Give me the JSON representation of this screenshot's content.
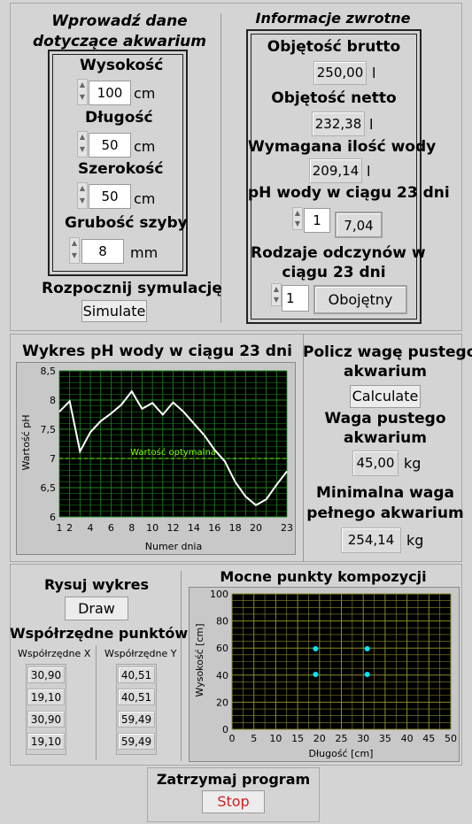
{
  "input_section": {
    "title_line1": "Wprowadź dane",
    "title_line2": "dotyczące akwarium",
    "height_label": "Wysokość",
    "height_value": "100",
    "height_unit": "cm",
    "length_label": "Długość",
    "length_value": "50",
    "length_unit": "cm",
    "width_label": "Szerokość",
    "width_value": "50",
    "width_unit": "cm",
    "glass_label": "Grubość szyby",
    "glass_value": "8",
    "glass_unit": "mm",
    "sim_label": "Rozpocznij symulację",
    "sim_button": "Simulate"
  },
  "feedback_section": {
    "title": "Informacje zwrotne",
    "gross_label": "Objętość brutto",
    "gross_value": "250,00",
    "gross_unit": "l",
    "net_label": "Objętość netto",
    "net_value": "232,38",
    "net_unit": "l",
    "water_label": "Wymagana ilość wody",
    "water_value": "209,14",
    "water_unit": "l",
    "ph_label": "pH wody w ciągu 23 dni",
    "ph_day": "1",
    "ph_value": "7,04",
    "reaction_label_line1": "Rodzaje odczynów w",
    "reaction_label_line2": "ciągu 23 dni",
    "reaction_day": "1",
    "reaction_value": "Obojętny"
  },
  "ph_chart": {
    "title": "Wykres pH wody w ciągu 23 dni",
    "optimal_label": "Wartość optymalna",
    "colors": {
      "bg": "#000000",
      "grid": "#1e8a1e",
      "line": "#ffffff",
      "optimal": "#7cfc00"
    }
  },
  "weight_section": {
    "calc_label_line1": "Policz wagę pustego",
    "calc_label_line2": "akwarium",
    "calc_button": "Calculate",
    "empty_label_line1": "Waga pustego",
    "empty_label_line2": "akwarium",
    "empty_value": "45,00",
    "empty_unit": "kg",
    "full_label_line1": "Minimalna waga",
    "full_label_line2": "pełnego akwarium",
    "full_value": "254,14",
    "full_unit": "kg"
  },
  "draw_section": {
    "draw_label": "Rysuj wykres",
    "draw_button": "Draw",
    "coords_label": "Współrzędne punktów",
    "x_header": "Współrzędne X",
    "y_header": "Współrzędne Y",
    "x_values": [
      "30,90",
      "19,10",
      "30,90",
      "19,10"
    ],
    "y_values": [
      "40,51",
      "40,51",
      "59,49",
      "59,49"
    ]
  },
  "composition_chart": {
    "title": "Mocne punkty kompozycji",
    "colors": {
      "bg": "#000000",
      "grid": "#8a8a2a",
      "point": "#00e5ff"
    }
  },
  "stop_section": {
    "label": "Zatrzymaj program",
    "button": "Stop",
    "button_color": "#d02020"
  },
  "chart_data": [
    {
      "type": "line",
      "title": "Wykres pH wody w ciągu 23 dni",
      "xlabel": "Numer dnia",
      "ylabel": "Wartość pH",
      "x": [
        1,
        2,
        3,
        4,
        5,
        6,
        7,
        8,
        9,
        10,
        11,
        12,
        13,
        14,
        15,
        16,
        17,
        18,
        19,
        20,
        21,
        22,
        23
      ],
      "series": [
        {
          "values": [
            7.8,
            7.98,
            7.12,
            7.45,
            7.64,
            7.77,
            7.92,
            8.15,
            7.85,
            7.95,
            7.75,
            7.96,
            7.8,
            7.6,
            7.4,
            7.15,
            6.95,
            6.6,
            6.35,
            6.2,
            6.3,
            6.55,
            6.78
          ]
        }
      ],
      "reference_line": {
        "label": "Wartość optymalna",
        "y": 7.0
      },
      "xlim": [
        1,
        23
      ],
      "ylim": [
        6,
        8.5
      ],
      "x_ticks": [
        1,
        2,
        4,
        6,
        8,
        10,
        12,
        14,
        16,
        18,
        20,
        23
      ],
      "y_ticks": [
        "6",
        "6,5",
        "7",
        "7,5",
        "8",
        "8,5"
      ],
      "grid": true
    },
    {
      "type": "scatter",
      "title": "Mocne punkty kompozycji",
      "xlabel": "Długość [cm]",
      "ylabel": "Wysokość [cm]",
      "series": [
        {
          "x": [
            19.1,
            30.9,
            19.1,
            30.9
          ],
          "y": [
            40.51,
            40.51,
            59.49,
            59.49
          ]
        }
      ],
      "xlim": [
        0,
        50
      ],
      "ylim": [
        0,
        100
      ],
      "x_ticks": [
        0,
        5,
        10,
        15,
        20,
        25,
        30,
        35,
        40,
        45,
        50
      ],
      "y_ticks": [
        0,
        20,
        40,
        60,
        80,
        100
      ],
      "grid": true
    }
  ]
}
